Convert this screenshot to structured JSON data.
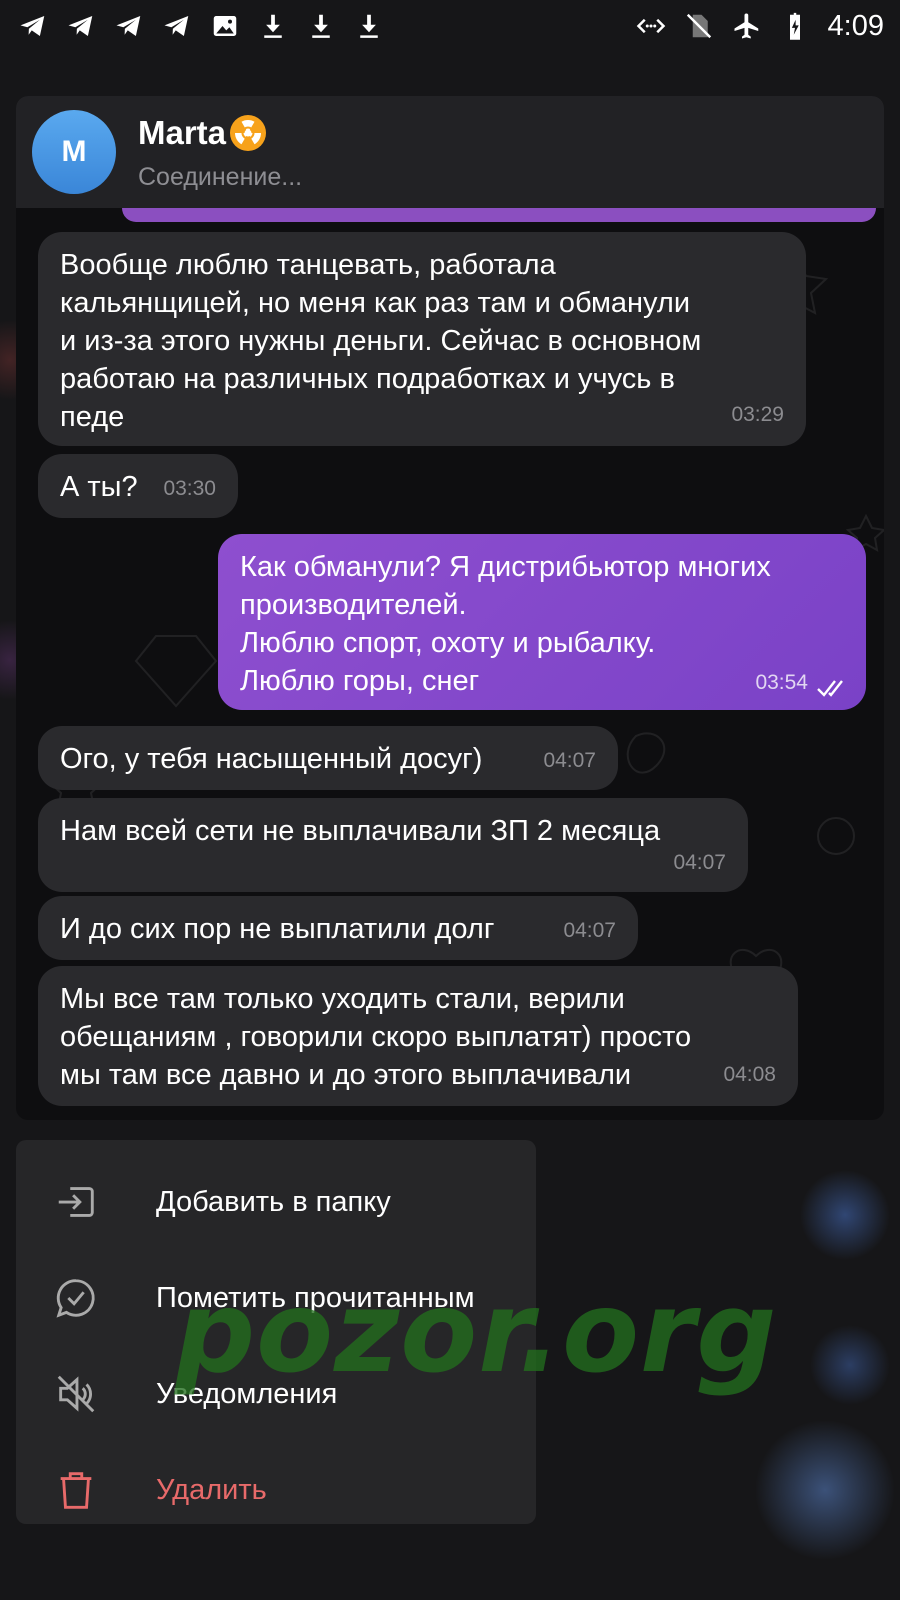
{
  "status_bar": {
    "time": "4:09",
    "left_icons": [
      "telegram-icon",
      "telegram-icon",
      "telegram-icon",
      "telegram-icon",
      "image-icon",
      "download-icon",
      "download-icon",
      "download-icon"
    ],
    "right_icons": [
      "data-saver-icon",
      "no-sim-icon",
      "airplane-icon",
      "battery-charging-icon"
    ]
  },
  "chat": {
    "avatar_letter": "M",
    "avatar_color": "#4a98e6",
    "name": "Marta",
    "status": "Соединение...",
    "accent_out": "#8a4dcc",
    "messages": [
      {
        "dir": "in",
        "text": "Вообще люблю танцевать, работала\nкальянщицей, но меня как раз там и обманули\nи из-за этого нужны деньги. Сейчас в основном\nработаю на различных подработках и учусь в\nпеде",
        "time": "03:29"
      },
      {
        "dir": "in",
        "text": "А ты?",
        "time": "03:30"
      },
      {
        "dir": "out",
        "text": "Как обманули? Я дистрибьютор многих\nпроизводителей.\nЛюблю спорт, охоту и рыбалку.\nЛюблю горы, снег",
        "time": "03:54",
        "read": true
      },
      {
        "dir": "in",
        "text": "Ого, у тебя насыщенный досуг)",
        "time": "04:07"
      },
      {
        "dir": "in",
        "text": "Нам всей сети не выплачивали ЗП 2 месяца",
        "time": "04:07"
      },
      {
        "dir": "in",
        "text": "И до сих пор не выплатили долг",
        "time": "04:07"
      },
      {
        "dir": "in",
        "text": "Мы все там только уходить стали, верили\nобещаниям , говорили скоро выплатят) просто\nмы там все давно и до этого выплачивали",
        "time": "04:08"
      }
    ]
  },
  "menu": {
    "items": [
      {
        "label": "Добавить в папку",
        "icon": "folder-add-icon"
      },
      {
        "label": "Пометить прочитанным",
        "icon": "chat-check-icon"
      },
      {
        "label": "Уведомления",
        "icon": "mute-icon"
      },
      {
        "label": "Удалить",
        "icon": "trash-icon",
        "color": "#e86a6a"
      }
    ]
  },
  "watermark": "pozor.org"
}
